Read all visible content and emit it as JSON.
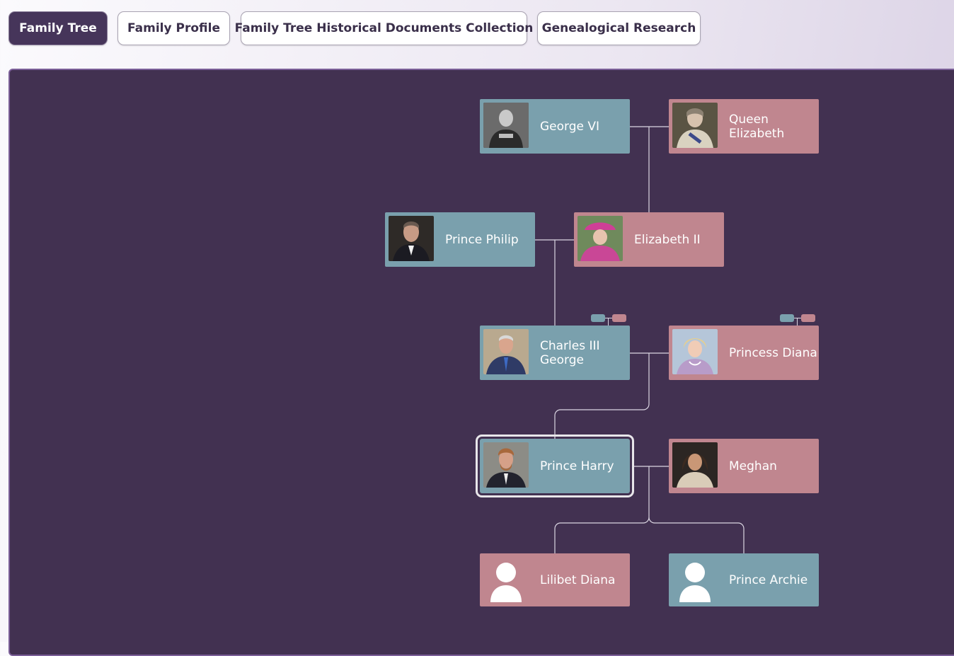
{
  "tabs": [
    {
      "label": "Family Tree",
      "active": true
    },
    {
      "label": "Family Profile",
      "active": false
    },
    {
      "label": "Family Tree Historical Documents Collection",
      "active": false
    },
    {
      "label": "Genealogical Research",
      "active": false
    }
  ],
  "people": {
    "george_vi": {
      "name": "George VI",
      "gender": "male",
      "photo": "portrait-photo-bw"
    },
    "queen_elizabeth": {
      "name": "Queen Elizabeth",
      "gender": "female",
      "photo": "portrait-photo"
    },
    "prince_philip": {
      "name": "Prince Philip",
      "gender": "male",
      "photo": "portrait-photo"
    },
    "elizabeth_ii": {
      "name": "Elizabeth II",
      "gender": "female",
      "photo": "portrait-photo"
    },
    "charles_iii": {
      "name": "Charles III\nGeorge",
      "gender": "male",
      "photo": "portrait-photo"
    },
    "princess_diana": {
      "name": "Princess Diana",
      "gender": "female",
      "photo": "portrait-photo"
    },
    "prince_harry": {
      "name": "Prince Harry",
      "gender": "male",
      "photo": "portrait-photo",
      "selected": true
    },
    "meghan": {
      "name": "Meghan",
      "gender": "female",
      "photo": "portrait-photo"
    },
    "lilibet_diana": {
      "name": "Lilibet Diana",
      "gender": "female",
      "photo": "avatar-placeholder-icon"
    },
    "prince_archie": {
      "name": "Prince Archie",
      "gender": "male",
      "photo": "avatar-placeholder-icon"
    }
  },
  "colors": {
    "male": "#7aa0ad",
    "female": "#c0868f",
    "canvas": "#423151",
    "active_tab": "#46355a",
    "link": "#dcd7e3"
  }
}
